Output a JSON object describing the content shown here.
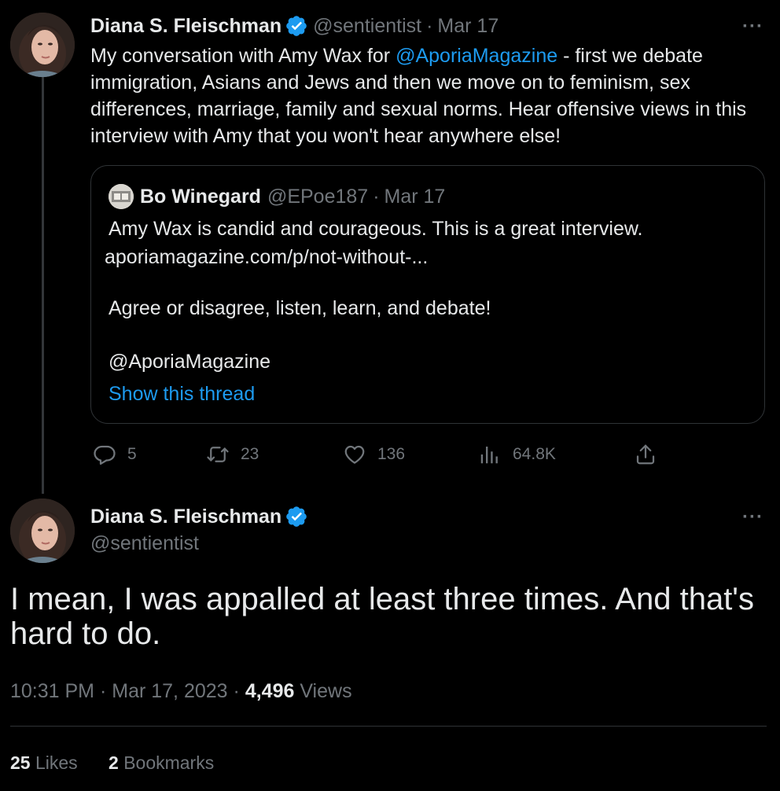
{
  "parent_tweet": {
    "author_name": "Diana S. Fleischman",
    "handle": "@sentientist",
    "date": "Mar 17",
    "more_label": "···",
    "text_parts": {
      "before": "My conversation with Amy Wax for ",
      "mention": "@AporiaMagazine",
      "after": " - first we debate immigration, Asians and Jews and then we move on to feminism, sex differences, marriage, family and sexual norms. Hear offensive views in this interview with Amy that you won't hear anywhere else!"
    },
    "quoted": {
      "author_name": "Bo Winegard",
      "handle": "@EPoe187",
      "date": "Mar 17",
      "line1": "Amy Wax is candid and courageous. This is a great interview.",
      "link": "aporiamagazine.com/p/not-without-...",
      "line2": "Agree or disagree, listen, learn, and debate!",
      "line3": "@AporiaMagazine",
      "show_thread": "Show this thread"
    },
    "actions": {
      "replies": "5",
      "retweets": "23",
      "likes": "136",
      "views": "64.8K"
    }
  },
  "focal_tweet": {
    "author_name": "Diana S. Fleischman",
    "handle": "@sentientist",
    "more_label": "···",
    "text": "I mean, I was appalled at least three times. And that's hard to do.",
    "time": "10:31 PM",
    "date": "Mar 17, 2023",
    "views_count": "4,496",
    "views_label": "Views",
    "likes_count": "25",
    "likes_label": "Likes",
    "bookmarks_count": "2",
    "bookmarks_label": "Bookmarks"
  },
  "colors": {
    "background": "#000000",
    "text": "#e7e9ea",
    "muted": "#71767b",
    "accent": "#1d9bf0",
    "border": "#2f3336"
  },
  "icons": [
    "verified-badge-icon",
    "more-icon",
    "reply-icon",
    "retweet-icon",
    "like-icon",
    "views-icon",
    "share-icon"
  ]
}
